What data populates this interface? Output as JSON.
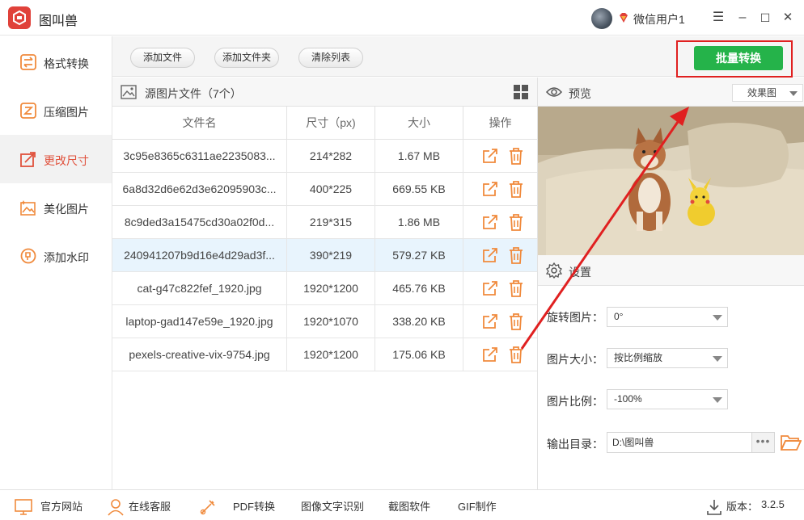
{
  "app": {
    "name": "图叫兽",
    "user_name": "微信用户1",
    "version_label": "版本：",
    "version": "3.2.5"
  },
  "window_controls": {
    "menu": "☰",
    "minimize": "–",
    "maximize": "☐",
    "close": "✕"
  },
  "sidebar": {
    "items": [
      {
        "label": "格式转换",
        "icon": "format-convert-icon"
      },
      {
        "label": "压缩图片",
        "icon": "compress-icon"
      },
      {
        "label": "更改尺寸",
        "icon": "resize-icon",
        "active": true
      },
      {
        "label": "美化图片",
        "icon": "beautify-icon"
      },
      {
        "label": "添加水印",
        "icon": "watermark-icon"
      }
    ]
  },
  "toolbar": {
    "add_file": "添加文件",
    "add_folder": "添加文件夹",
    "clear_list": "清除列表",
    "batch_convert": "批量转换"
  },
  "file_panel": {
    "title": "源图片文件（7个）",
    "columns": [
      "文件名",
      "尺寸（px)",
      "大小",
      "操作"
    ],
    "rows": [
      {
        "name": "3c95e8365c6311ae2235083...",
        "size_px": "214*282",
        "size": "1.67 MB"
      },
      {
        "name": "6a8d32d6e62d3e62095903c...",
        "size_px": "400*225",
        "size": "669.55 KB"
      },
      {
        "name": "8c9ded3a15475cd30a02f0d...",
        "size_px": "219*315",
        "size": "1.86 MB"
      },
      {
        "name": "240941207b9d16e4d29ad3f...",
        "size_px": "390*219",
        "size": "579.27 KB",
        "selected": true
      },
      {
        "name": "cat-g47c822fef_1920.jpg",
        "size_px": "1920*1200",
        "size": "465.76 KB"
      },
      {
        "name": "laptop-gad147e59e_1920.jpg",
        "size_px": "1920*1070",
        "size": "338.20 KB"
      },
      {
        "name": "pexels-creative-vix-9754.jpg",
        "size_px": "1920*1200",
        "size": "175.06 KB"
      }
    ]
  },
  "preview": {
    "title": "预览",
    "mode": "效果图"
  },
  "settings": {
    "title": "设置",
    "rotate_label": "旋转图片：",
    "rotate_value": "0°",
    "size_label": "图片大小：",
    "size_value": "按比例缩放",
    "ratio_label": "图片比例：",
    "ratio_value": "-100%",
    "output_label": "输出目录：",
    "output_value": "D:\\图叫兽",
    "more": "•••"
  },
  "footer": {
    "items": [
      "官方网站",
      "在线客服",
      "PDF转换",
      "图像文字识别",
      "截图软件",
      "GIF制作"
    ]
  },
  "colors": {
    "accent": "#e0513c",
    "convert_green": "#25b34a",
    "highlight_red": "#e02020",
    "icon_orange": "#f08a3c"
  }
}
